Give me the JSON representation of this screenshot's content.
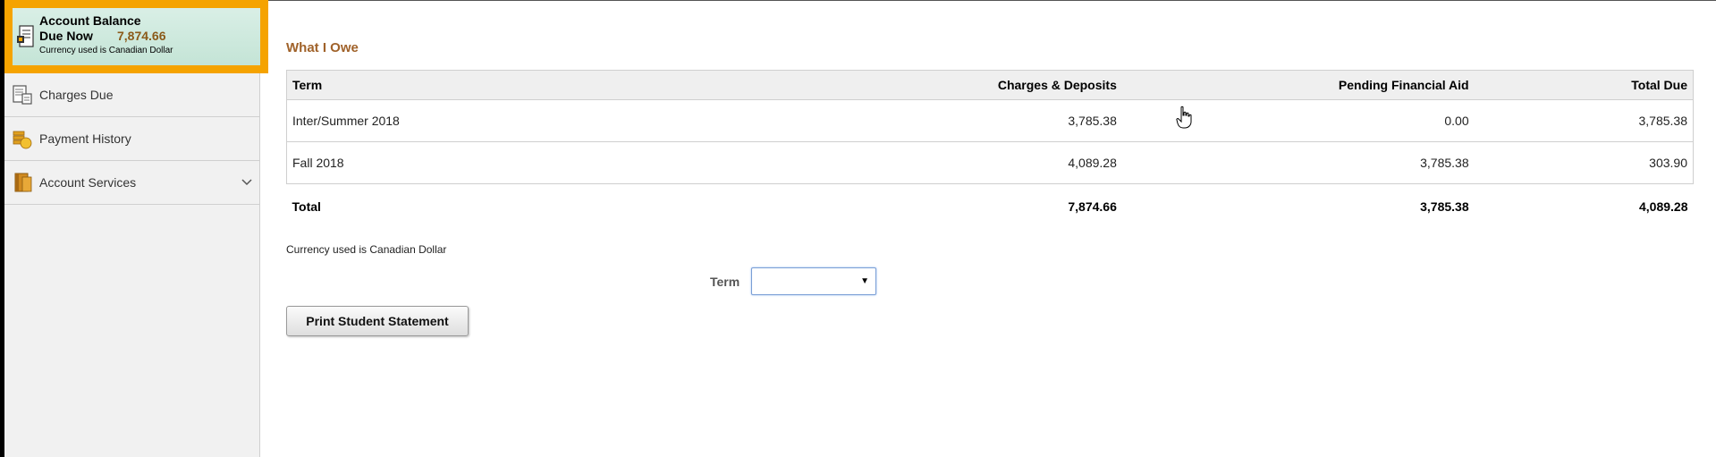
{
  "sidebar": {
    "balance": {
      "title": "Account Balance",
      "due_label": "Due Now",
      "due_amount": "7,874.66",
      "currency_note": "Currency used is Canadian Dollar",
      "icon": "statement-icon"
    },
    "items": [
      {
        "label": "Charges Due",
        "icon": "charges-icon"
      },
      {
        "label": "Payment History",
        "icon": "coins-icon"
      },
      {
        "label": "Account Services",
        "icon": "book-icon",
        "expandable": true
      }
    ]
  },
  "main": {
    "section_title": "What I Owe",
    "table": {
      "headers": [
        "Term",
        "Charges & Deposits",
        "Pending Financial Aid",
        "Total Due"
      ],
      "rows": [
        [
          "Inter/Summer 2018",
          "3,785.38",
          "0.00",
          "3,785.38"
        ],
        [
          "Fall 2018",
          "4,089.28",
          "3,785.38",
          "303.90"
        ]
      ],
      "total": [
        "Total",
        "7,874.66",
        "3,785.38",
        "4,089.28"
      ]
    },
    "currency_note": "Currency used is Canadian Dollar",
    "term_filter": {
      "label": "Term",
      "value": ""
    },
    "print_button": "Print Student Statement"
  },
  "colors": {
    "highlight_border": "#f5a300",
    "balance_bg": "#c4e4d6",
    "title_brown": "#a0622a",
    "amount_brown": "#8b5a1a"
  }
}
